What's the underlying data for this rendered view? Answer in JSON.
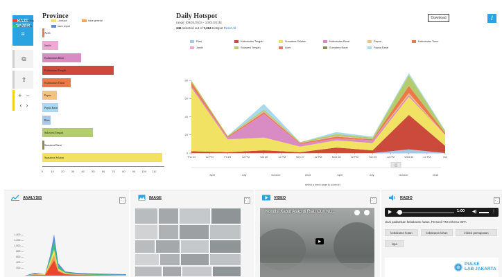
{
  "app": {
    "logo_lines": [
      "HAZE",
      "GAZER"
    ],
    "menu_glyph": "≡"
  },
  "rail": {
    "buttons": [
      {
        "name": "map-layers-icon",
        "glyph": "⧉"
      },
      {
        "name": "upload-icon",
        "glyph": "⇪"
      }
    ],
    "zoom_in": "+",
    "zoom_out": "−",
    "prev": "‹",
    "next": "›"
  },
  "province": {
    "title": "Province",
    "axis_ticks": [
      "0",
      "10",
      "20",
      "30",
      "40",
      "50",
      "60",
      "70",
      "80",
      "90",
      "100",
      "110"
    ],
    "items": [
      {
        "label": "Aceh",
        "value": 2,
        "color": "#e27a63"
      },
      {
        "label": "Jambi",
        "value": 16,
        "color": "#f0a9d4"
      },
      {
        "label": "Kalimantan Barat",
        "value": 38,
        "color": "#d98bc4"
      },
      {
        "label": "Kalimantan Tengah",
        "value": 70,
        "color": "#cc4a3c"
      },
      {
        "label": "Kalimantan Timur",
        "value": 28,
        "color": "#eb7a48"
      },
      {
        "label": "Papua",
        "value": 14,
        "color": "#f4c27e"
      },
      {
        "label": "Papua Barat",
        "value": 16,
        "color": "#a9d9ee"
      },
      {
        "label": "Riau",
        "value": 8,
        "color": "#a7c7e6"
      },
      {
        "label": "Sulawesi Tengah",
        "value": 50,
        "color": "#b4cc6b"
      },
      {
        "label": "Sumatera Barat",
        "value": 1,
        "color": "#8a8a5a"
      },
      {
        "label": "Sumatera Selatan",
        "value": 118,
        "color": "#f1e264"
      }
    ]
  },
  "chart": {
    "title": "Daily Hotspot",
    "range": "range: [09/24/2015 - 10/01/2015]",
    "selected_count": "346",
    "selected_text": "selected out of",
    "total_count": "7,364",
    "total_suffix": "Hotspot",
    "reset_label": "Reset All",
    "download_label": "Download",
    "info_glyph": "i",
    "brush_note": "select a time range to zoom in",
    "brush_center_glyph": "◫",
    "brush_ticks": [
      "April",
      "July",
      "October",
      "2015",
      "April",
      "July",
      "October",
      "2015"
    ]
  },
  "chart_data": {
    "type": "area",
    "title": "Daily Hotspot",
    "stacked": true,
    "ylim": [
      0,
      90
    ],
    "y_ticks": [
      0,
      20,
      40,
      60,
      80
    ],
    "x_ticks": [
      "Thu 24",
      "12 PM",
      "Fri 25",
      "12 PM",
      "Sat 26",
      "12 PM",
      "Sep 27",
      "12 PM",
      "Mon 28",
      "12 PM",
      "Tue 29",
      "12 PM",
      "Wed 30",
      "12 PM",
      "Oct"
    ],
    "x_points": [
      0,
      2,
      4,
      6,
      8,
      10,
      12,
      14
    ],
    "series": [
      {
        "name": "Riau",
        "color": "#a7c7e6",
        "values": [
          0,
          0,
          0,
          0,
          0,
          0,
          4,
          0
        ]
      },
      {
        "name": "Kalimantan Tengah",
        "color": "#cc4a3c",
        "values": [
          2,
          1,
          3,
          1,
          6,
          3,
          38,
          8
        ]
      },
      {
        "name": "Sumatera Selatan",
        "color": "#f1e264",
        "values": [
          70,
          14,
          14,
          6,
          8,
          8,
          20,
          12
        ]
      },
      {
        "name": "Kalimantan Barat",
        "color": "#d98bc4",
        "values": [
          2,
          2,
          26,
          3,
          2,
          3,
          2,
          0
        ]
      },
      {
        "name": "Papua",
        "color": "#f4c27e",
        "values": [
          0,
          0,
          0,
          0,
          0,
          0,
          2,
          0
        ]
      },
      {
        "name": "Kalimantan Timur",
        "color": "#eb7a48",
        "values": [
          4,
          1,
          2,
          1,
          2,
          1,
          8,
          2
        ]
      },
      {
        "name": "Jambi",
        "color": "#f0a9d4",
        "values": [
          0,
          0,
          1,
          0,
          1,
          0,
          0,
          0
        ]
      },
      {
        "name": "Sulawesi Tengah",
        "color": "#b4cc6b",
        "values": [
          2,
          1,
          2,
          1,
          2,
          2,
          12,
          2
        ]
      },
      {
        "name": "Aceh",
        "color": "#e27a63",
        "values": [
          0,
          0,
          0,
          0,
          0,
          0,
          0,
          0
        ]
      },
      {
        "name": "Sumatera Barat",
        "color": "#8a8a5a",
        "values": [
          0,
          0,
          0,
          0,
          0,
          0,
          0,
          0
        ]
      },
      {
        "name": "Papua Barat",
        "color": "#a9d9ee",
        "values": [
          0,
          0,
          6,
          0,
          2,
          1,
          2,
          1
        ]
      }
    ]
  },
  "analysis": {
    "title": "ANALYSIS",
    "expand_glyph": "⛶",
    "legend": [
      {
        "label": "haze hashtag",
        "color": "#e8472d"
      },
      {
        "label": "_hotspot",
        "color": "#f1e264"
      },
      {
        "label": "haze general",
        "color": "#f2a35a"
      },
      {
        "label": "haze health",
        "color": "#3bbf7a"
      },
      {
        "label": "haze report",
        "color": "#5d8fd6"
      }
    ],
    "y_ticks": [
      "1,400 —",
      "1,200 —",
      "1,000 —",
      "800 —",
      "600 —",
      "400 —",
      "200 —"
    ]
  },
  "image": {
    "title": "IMAGE",
    "expand_glyph": "⛶"
  },
  "video": {
    "title": "VIDEO",
    "expand_glyph": "⛶",
    "clip_title": "Kondisi Kabut Asap di Riau (Jun Nu...",
    "play_glyph": "▶"
  },
  "radio": {
    "title": "RADIO",
    "expand_glyph": "⛶",
    "time": "1:00",
    "volume_glyph": "◀)",
    "menu_glyph": "⋮",
    "caption": "Usai padamkan kebakaran hutan, Personil TNI terkena ISPA",
    "tags": [
      "kebakaran hutan",
      "kebakaran lahan",
      "infeksi pernapasan",
      "ispa"
    ],
    "brand_line1": "PULSE",
    "brand_line2": "LAB JAKARTA"
  }
}
